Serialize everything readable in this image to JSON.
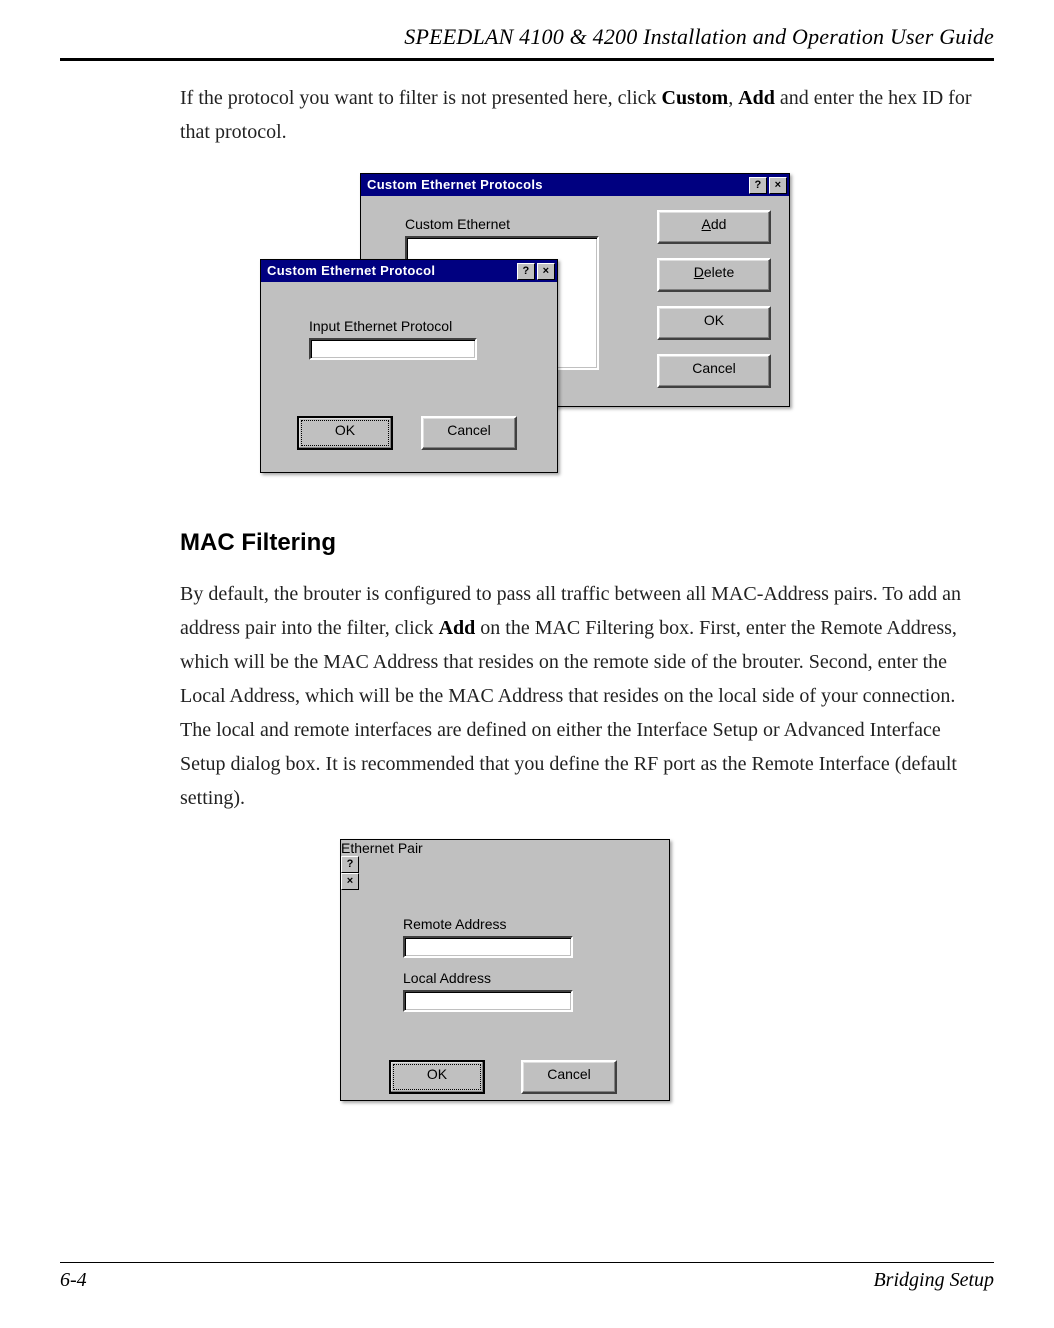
{
  "header": {
    "title": "SPEEDLAN 4100 & 4200 Installation and Operation User Guide"
  },
  "intro": {
    "text_before": "If the protocol you want to filter is not presented here, click ",
    "bold1": "Custom",
    "sep": ", ",
    "bold2": "Add",
    "text_after": " and enter the hex ID for that protocol."
  },
  "dialog1": {
    "title": "Custom Ethernet Protocols",
    "list_label": "Custom Ethernet",
    "buttons": {
      "add": "Add",
      "delete": "Delete",
      "ok": "OK",
      "cancel": "Cancel"
    },
    "help_glyph": "?",
    "close_glyph": "×"
  },
  "dialog2": {
    "title": "Custom Ethernet Protocol",
    "input_label": "Input Ethernet Protocol",
    "input_value": "",
    "ok": "OK",
    "cancel": "Cancel",
    "help_glyph": "?",
    "close_glyph": "×"
  },
  "section": {
    "heading": "MAC Filtering",
    "para_before": "By default, the brouter is configured to pass all traffic between all MAC-Address pairs. To add an address pair into the filter, click ",
    "bold": "Add",
    "para_after": " on the MAC Filtering box. First, enter the Remote Address, which will be the MAC Address that resides on the remote side of the brouter. Second, enter the Local Address, which will be the MAC Address that resides on the local side of your connection. The local and remote interfaces are defined on either the Interface Setup or Advanced Interface Setup dialog box. It is recommended that you define the RF port as the Remote Interface (default setting)."
  },
  "dialog3": {
    "title": "Ethernet Pair",
    "remote_label": "Remote Address",
    "remote_value": "",
    "local_label": "Local Address",
    "local_value": "",
    "ok": "OK",
    "cancel": "Cancel",
    "help_glyph": "?",
    "close_glyph": "×"
  },
  "footer": {
    "page": "6-4",
    "section": "Bridging Setup"
  }
}
